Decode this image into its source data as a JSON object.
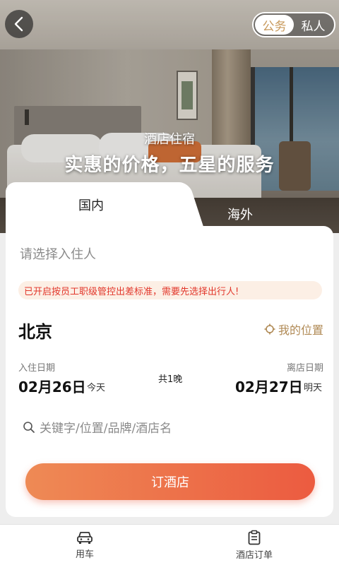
{
  "header": {
    "mode_tabs": [
      {
        "label": "公务",
        "active": true
      },
      {
        "label": "私人",
        "active": false
      }
    ]
  },
  "hero": {
    "subtitle": "酒店住宿",
    "title": "实惠的价格，五星的服务"
  },
  "region_tabs": [
    {
      "label": "国内",
      "active": true
    },
    {
      "label": "海外",
      "active": false
    }
  ],
  "form": {
    "guest_placeholder": "请选择入住人",
    "warning": "已开启按员工职级管控出差标准，需要先选择出行人!",
    "city": "北京",
    "my_location": "我的位置",
    "checkin_label": "入住日期",
    "checkin_date": "02月26日",
    "checkin_day": "今天",
    "nights": "共1晚",
    "checkout_label": "离店日期",
    "checkout_date": "02月27日",
    "checkout_day": "明天",
    "search_placeholder": "关键字/位置/品牌/酒店名",
    "book_button": "订酒店"
  },
  "bottom_nav": [
    {
      "label": "用车",
      "icon": "car-icon"
    },
    {
      "label": "酒店订单",
      "icon": "clipboard-icon"
    }
  ],
  "colors": {
    "accent_gold": "#b08a55",
    "warning_red": "#e2372b",
    "button_start": "#ee8a55",
    "button_end": "#ec5b40"
  }
}
